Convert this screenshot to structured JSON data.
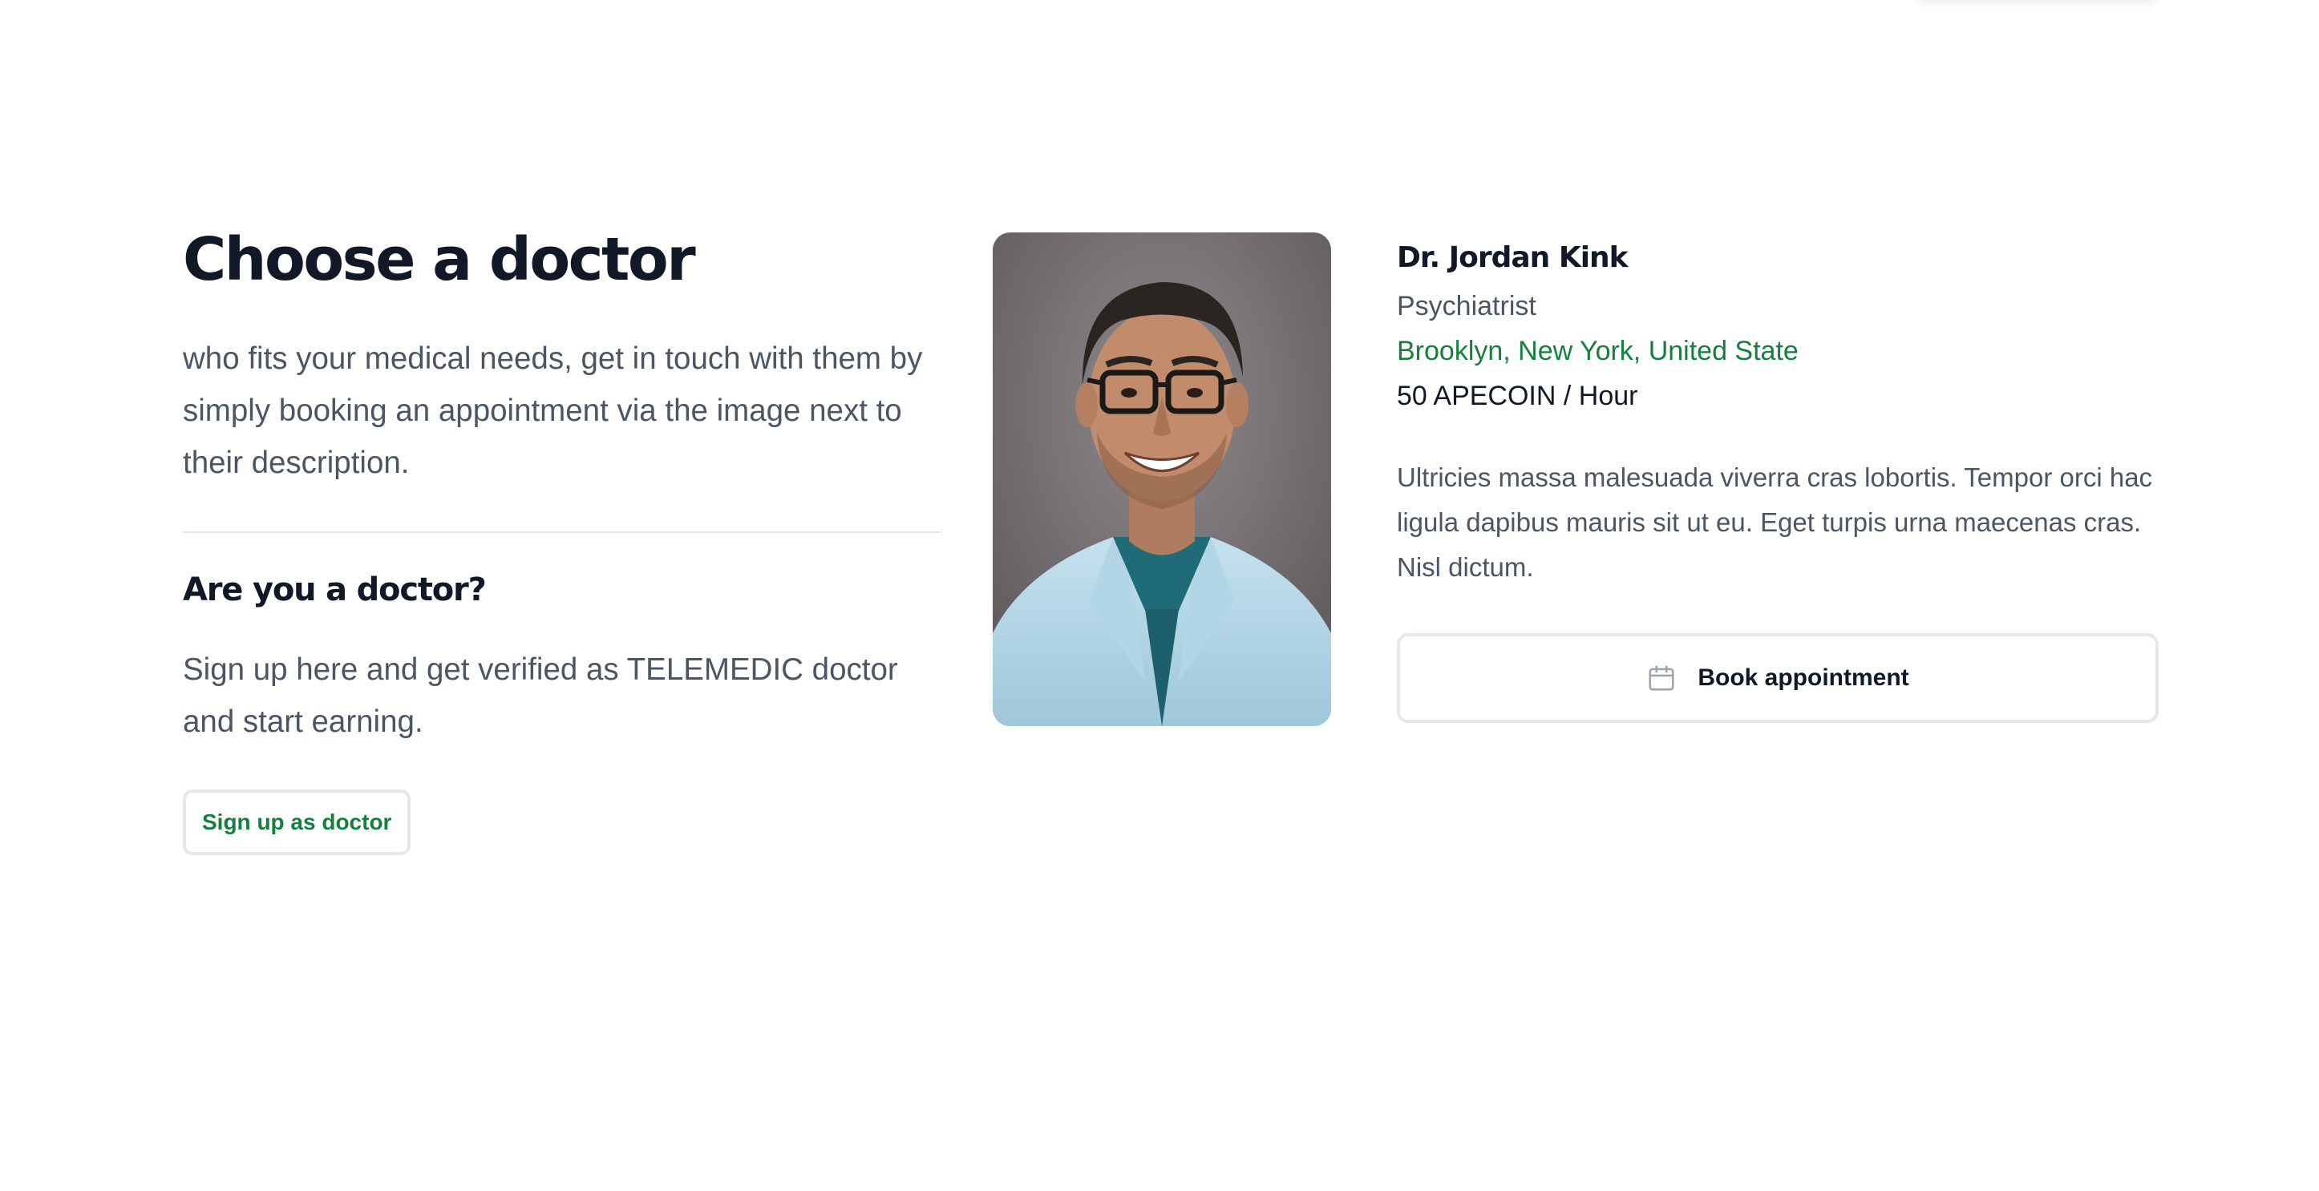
{
  "intro": {
    "title": "Choose a doctor",
    "description": "who fits your medical needs, get in touch with them by simply booking an appointment via the image next to their description."
  },
  "doctor_cta": {
    "title": "Are you a doctor?",
    "description": "Sign up here and get verified as TELEMEDIC doctor and start earning.",
    "button_label": "Sign up as doctor"
  },
  "doctor": {
    "name": "Dr. Jordan Kink",
    "specialty": "Psychiatrist",
    "location": "Brooklyn, New York, United State",
    "rate": "50 APECOIN / Hour",
    "bio": "Ultricies massa malesuada viverra cras lobortis. Tempor orci hac ligula dapibus mauris sit ut eu. Eget turpis urna maecenas cras. Nisl dictum.",
    "book_label": "Book appointment",
    "book_icon": "calendar-icon",
    "photo_icon": "doctor-portrait"
  },
  "colors": {
    "accent_green": "#15803d",
    "heading": "#111827",
    "body_text": "#4b5563",
    "border": "#e5e7eb"
  }
}
